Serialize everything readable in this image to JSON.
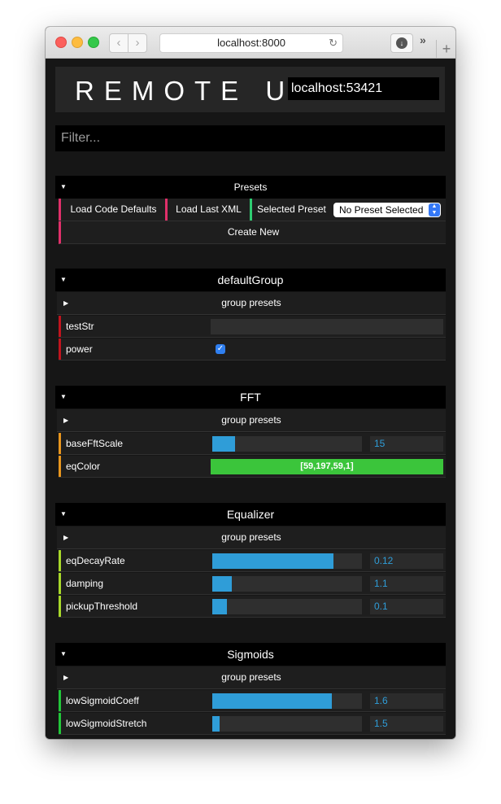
{
  "browser": {
    "url": "localhost:8000",
    "back_glyph": "‹",
    "forward_glyph": "›",
    "reload_glyph": "↻",
    "download_glyph": "↓",
    "more_glyph": "»",
    "newtab_glyph": "+"
  },
  "app": {
    "title": "REMOTE UI",
    "host": "localhost:53421",
    "filter_placeholder": "Filter..."
  },
  "presets": {
    "title": "Presets",
    "load_defaults": "Load Code Defaults",
    "load_xml": "Load Last XML",
    "selected_label": "Selected Preset",
    "selected_value": "No Preset Selected",
    "create_new": "Create New",
    "colors": {
      "load": "#e0306a",
      "selected": "#2ecc71"
    }
  },
  "caret_down": "▼",
  "caret_right": "▶",
  "check_glyph": "✓",
  "group_presets_label": "group presets",
  "groups": {
    "default": {
      "title": "defaultGroup",
      "accent": "#c0141e",
      "params": [
        {
          "label": "testStr",
          "type": "string",
          "value": ""
        },
        {
          "label": "power",
          "type": "bool",
          "value": true
        }
      ]
    },
    "fft": {
      "title": "FFT",
      "accent": "#e8961e",
      "params": [
        {
          "label": "baseFftScale",
          "type": "float",
          "value": "15",
          "fill": 0.15
        },
        {
          "label": "eqColor",
          "type": "color",
          "value": "[59,197,59,1]",
          "color": "#3bc53b"
        }
      ]
    },
    "equalizer": {
      "title": "Equalizer",
      "accent": "#a8d82a",
      "params": [
        {
          "label": "eqDecayRate",
          "type": "float",
          "value": "0.12",
          "fill": 0.81
        },
        {
          "label": "damping",
          "type": "float",
          "value": "1.1",
          "fill": 0.13
        },
        {
          "label": "pickupThreshold",
          "type": "float",
          "value": "0.1",
          "fill": 0.1
        }
      ]
    },
    "sigmoids": {
      "title": "Sigmoids",
      "accent": "#22c73a",
      "params": [
        {
          "label": "lowSigmoidCoeff",
          "type": "float",
          "value": "1.6",
          "fill": 0.8
        },
        {
          "label": "lowSigmoidStretch",
          "type": "float",
          "value": "1.5",
          "fill": 0.05
        }
      ]
    }
  }
}
